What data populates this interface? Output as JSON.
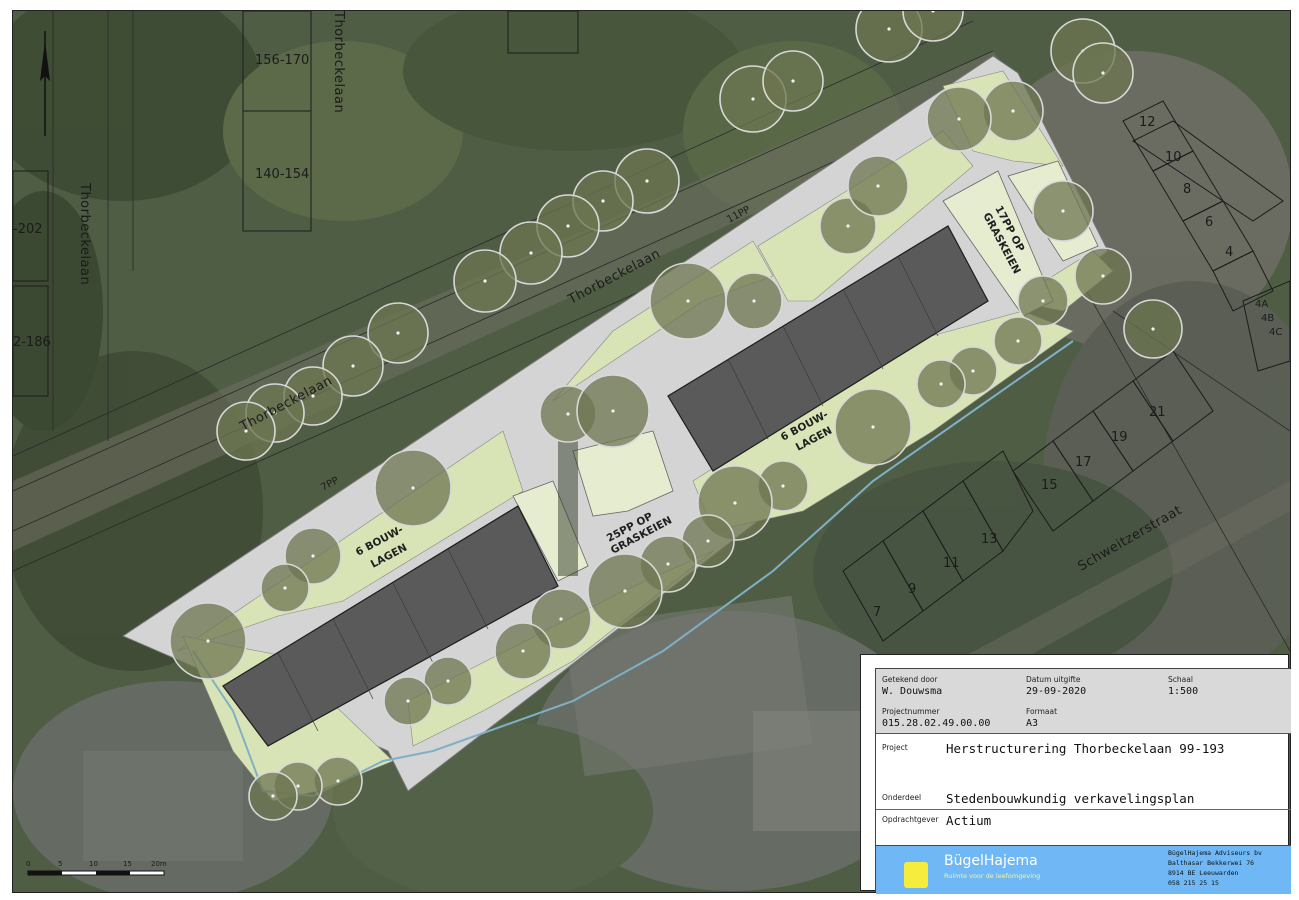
{
  "map": {
    "streets": {
      "thorbeckelaan_main": "Thorbeckelaan",
      "thorbeckelaan_west": "Thorbeckelaan",
      "thorbeckelaan_sw": "Thorbeckelaan",
      "thorbeckelaan_top": "Thorbeckelaan",
      "schweitzerstraat": "Schweitzerstraat"
    },
    "house_numbers": {
      "n156_170": "156-170",
      "n140_154": "140-154",
      "n202": "-202",
      "n186": "2-186",
      "n12": "12",
      "n10": "10",
      "n8": "8",
      "n6": "6",
      "n4": "4",
      "n4a": "4A",
      "n4b": "4B",
      "n4c": "4C",
      "n15": "15",
      "n17": "17",
      "n19": "19",
      "n21": "21",
      "n7": "7",
      "n9": "9",
      "n11": "11",
      "n13": "13"
    },
    "parking": {
      "p11": "11PP",
      "p7": "7PP",
      "p17_line1": "17PP OP",
      "p17_line2": "GRASKEIEN",
      "p25_line1": "25PP OP",
      "p25_line2": "GRASKEIEN"
    },
    "buildings": {
      "east_line1": "6 BOUW-",
      "east_line2": "LAGEN",
      "west_line1": "6 BOUW-",
      "west_line2": "LAGEN"
    },
    "scale_bar": {
      "ticks": [
        "0",
        "5",
        "10",
        "15",
        "20m"
      ]
    }
  },
  "title_block": {
    "drawn_by_caption": "Getekend door",
    "drawn_by": "W. Douwsma",
    "issue_date_caption": "Datum uitgifte",
    "issue_date": "29-09-2020",
    "scale_caption": "Schaal",
    "scale": "1:500",
    "project_number_caption": "Projectnummer",
    "project_number": "015.28.02.49.00.00",
    "format_caption": "Formaat",
    "format": "A3",
    "project_caption": "Project",
    "project": "Herstructurering Thorbeckelaan 99-193",
    "component_caption": "Onderdeel",
    "component": "Stedenbouwkundig verkavelingsplan",
    "client_caption": "Opdrachtgever",
    "client": "Actium",
    "company_name": "BügelHajema",
    "company_tagline": "Ruimte voor de leefomgeving",
    "company_full": "BügelHajema Adviseurs bv",
    "address_line1": "Balthasar Bekkerwei 76",
    "address_line2": "8914 BE Leeuwarden",
    "phone": "058 215 25 15"
  },
  "colors": {
    "aerial_base": "#4c5a40",
    "lawn": "#d9e4b6",
    "paving": "#d4d4d4",
    "building": "#5a5a5a",
    "tree_fill": "#6c7650",
    "logo_blue": "#6fb8f5",
    "logo_yellow": "#f5ec3c"
  }
}
